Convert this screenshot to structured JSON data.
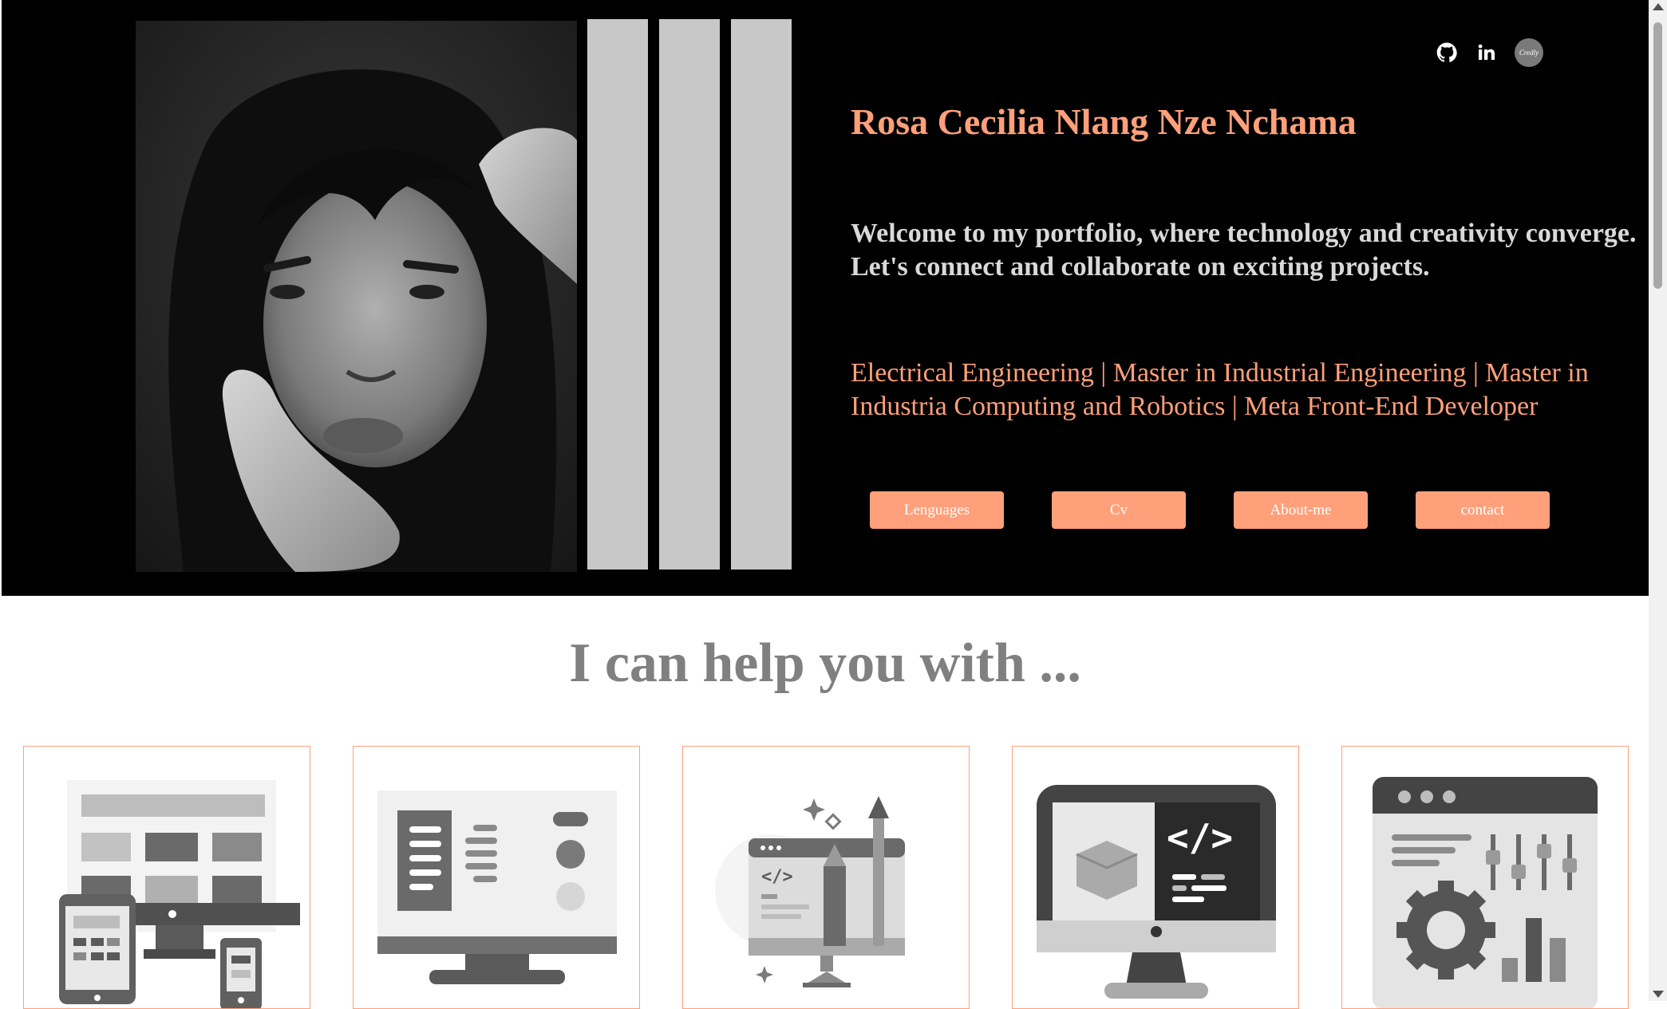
{
  "hero": {
    "name": "Rosa Cecilia Nlang Nze Nchama",
    "welcome": "Welcome to my portfolio, where technology and creativity converge. Let's connect and collaborate on exciting projects.",
    "tagline": "Electrical Engineering | Master in Industrial Engineering | Master in Industria Computing and Robotics | Meta Front-End Developer",
    "buttons": [
      "Lenguages",
      "Cv",
      "About-me",
      "contact"
    ],
    "socials": {
      "github_icon": "github-icon",
      "linkedin_icon": "linkedin-icon",
      "credly_label": "Credly"
    }
  },
  "services": {
    "title": "I can help you with ..."
  },
  "colors": {
    "accent": "#FFA07A",
    "hero_bg": "#000000",
    "title_gray": "#808080",
    "bar_gray": "#C8C8C8"
  }
}
